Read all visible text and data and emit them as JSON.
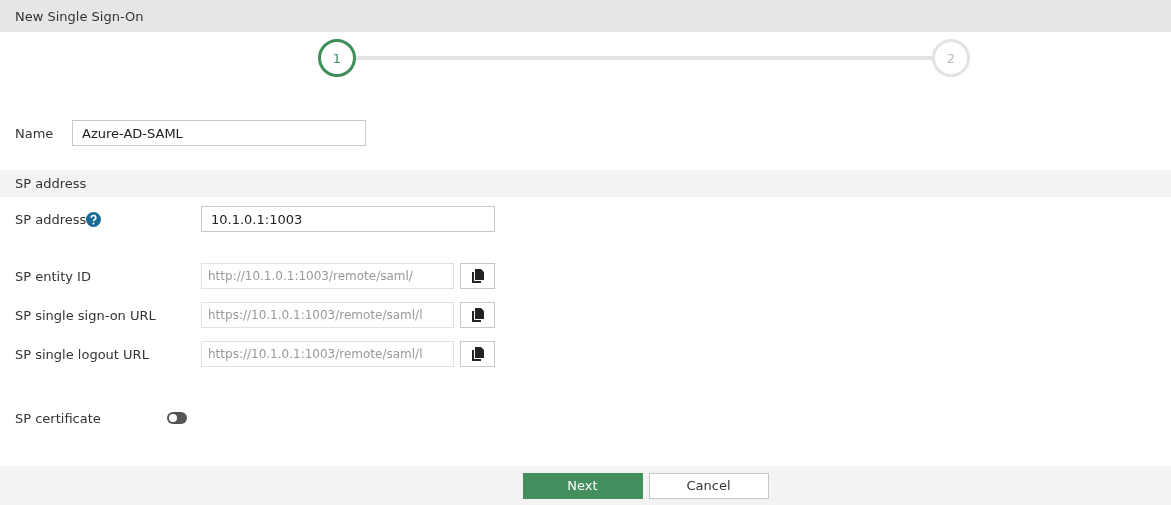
{
  "window": {
    "title": "New Single Sign-On"
  },
  "steps": [
    {
      "label": "1",
      "selected": true
    },
    {
      "label": "2",
      "selected": false
    }
  ],
  "name": {
    "label": "Name",
    "value": "Azure-AD-SAML"
  },
  "section": {
    "title": "SP address"
  },
  "sp_address": {
    "label": "SP address",
    "value": "10.1.0.1:1003"
  },
  "urls": [
    {
      "label": "SP entity ID",
      "value": "http://10.1.0.1:1003/remote/saml/"
    },
    {
      "label": "SP single sign-on URL",
      "value": "https://10.1.0.1:1003/remote/saml/l"
    },
    {
      "label": "SP single logout URL",
      "value": "https://10.1.0.1:1003/remote/saml/l"
    }
  ],
  "certificate": {
    "label": "SP certificate",
    "on": false
  },
  "buttons": [
    {
      "label": "Next",
      "kind": "primary"
    },
    {
      "label": "Cancel",
      "kind": "secondary"
    }
  ]
}
